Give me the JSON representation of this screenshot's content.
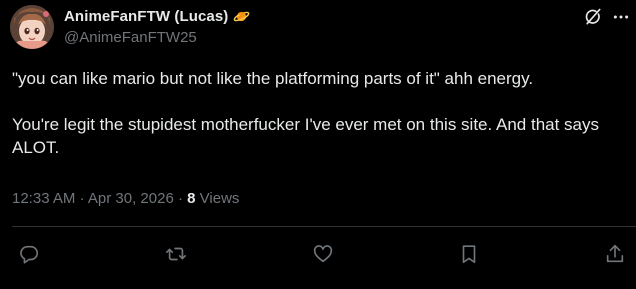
{
  "author": {
    "display_name": "AnimeFanFTW (Lucas)",
    "handle": "@AnimeFanFTW25",
    "badge_icon": "planet-icon"
  },
  "post": {
    "paragraphs": [
      "\"you can like mario but not like the platforming parts of it\" ahh energy.",
      "You're legit the stupidest motherfucker I've ever met on this site. And that says ALOT."
    ]
  },
  "meta": {
    "time": "12:33 AM",
    "separator_1": "·",
    "date": "Apr 30, 2026",
    "separator_2": "·",
    "views_count": "8",
    "views_label": "Views"
  },
  "header_icons": [
    "grok-icon",
    "more-icon"
  ],
  "actions": [
    "reply-icon",
    "repost-icon",
    "like-icon",
    "bookmark-icon",
    "share-icon"
  ],
  "colors": {
    "background": "#000000",
    "text_primary": "#e7e9ea",
    "text_secondary": "#71767b",
    "divider": "#2f3336",
    "badge": "#f4900c"
  }
}
